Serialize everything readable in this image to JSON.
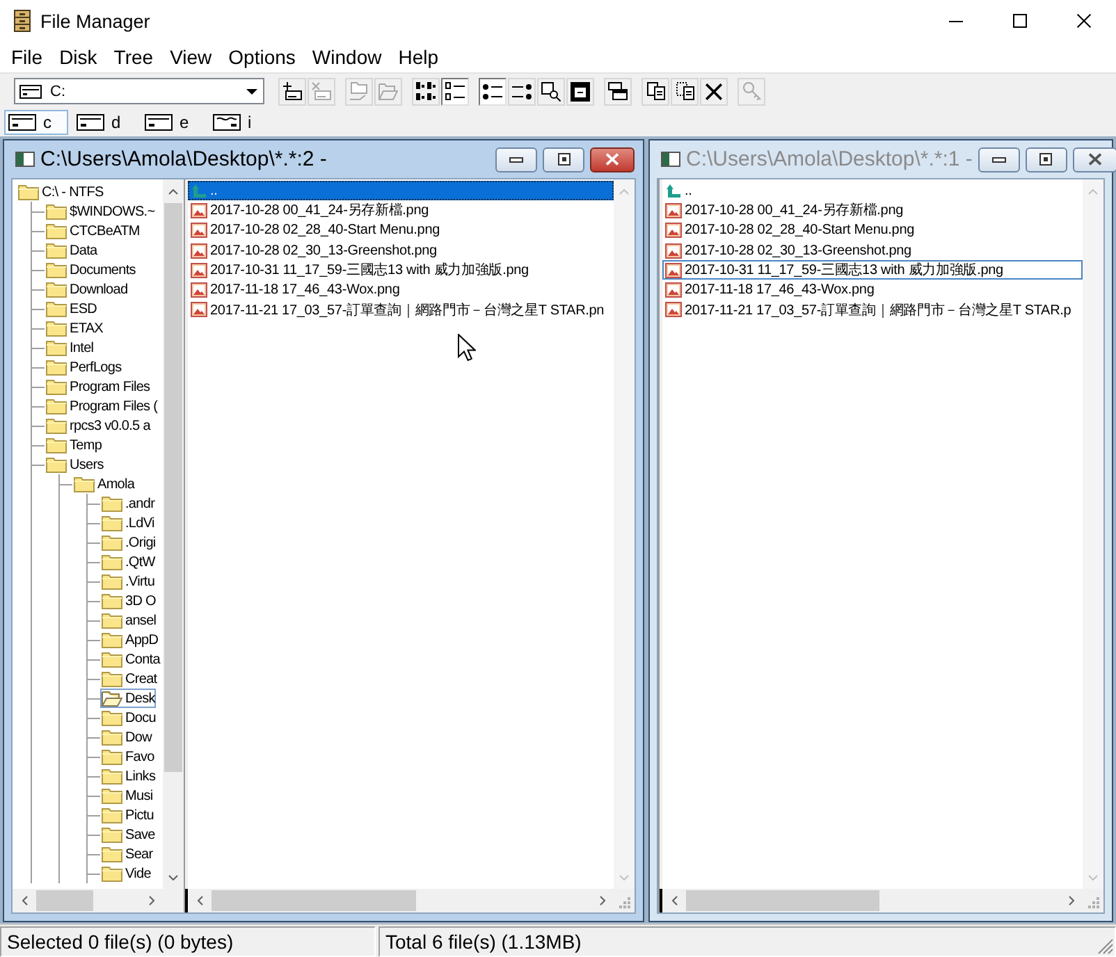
{
  "window": {
    "title": "File Manager"
  },
  "menu": [
    "File",
    "Disk",
    "Tree",
    "View",
    "Options",
    "Window",
    "Help"
  ],
  "toolbar": {
    "drive_combo": {
      "value": "C:"
    },
    "groups": [
      {
        "buttons": [
          {
            "kind": "connect",
            "pressed": false,
            "disabled": false
          },
          {
            "kind": "disconnect",
            "pressed": false,
            "disabled": true
          }
        ]
      },
      {
        "buttons": [
          {
            "kind": "share",
            "pressed": false,
            "disabled": true
          },
          {
            "kind": "unshare",
            "pressed": false,
            "disabled": true
          }
        ]
      },
      {
        "buttons": [
          {
            "kind": "grid",
            "pressed": false,
            "disabled": false
          },
          {
            "kind": "list",
            "pressed": true,
            "disabled": false
          }
        ]
      },
      {
        "buttons": [
          {
            "kind": "name",
            "pressed": true,
            "disabled": false
          },
          {
            "kind": "type",
            "pressed": false,
            "disabled": false
          },
          {
            "kind": "search",
            "pressed": false,
            "disabled": false
          },
          {
            "kind": "view",
            "pressed": false,
            "disabled": false
          }
        ]
      },
      {
        "buttons": [
          {
            "kind": "window",
            "pressed": false,
            "disabled": false
          }
        ]
      },
      {
        "buttons": [
          {
            "kind": "copy",
            "pressed": false,
            "disabled": false
          },
          {
            "kind": "move",
            "pressed": false,
            "disabled": false
          },
          {
            "kind": "delete",
            "pressed": false,
            "disabled": false
          }
        ]
      },
      {
        "buttons": [
          {
            "kind": "key",
            "pressed": false,
            "disabled": true
          }
        ]
      }
    ]
  },
  "drives": [
    {
      "letter": "c",
      "kind": "fixed",
      "selected": true
    },
    {
      "letter": "d",
      "kind": "fixed",
      "selected": false
    },
    {
      "letter": "e",
      "kind": "fixed",
      "selected": false
    },
    {
      "letter": "i",
      "kind": "network",
      "selected": false
    }
  ],
  "windows": [
    {
      "title": "C:\\Users\\Amola\\Desktop\\*.*:2 -",
      "active": true,
      "tree": [
        {
          "label": "C:\\ - NTFS",
          "selected": false,
          "children": [
            {
              "label": "$WINDOWS.~",
              "selected": false
            },
            {
              "label": "CTCBeATM",
              "selected": false
            },
            {
              "label": "Data",
              "selected": false
            },
            {
              "label": "Documents",
              "selected": false
            },
            {
              "label": "Download",
              "selected": false
            },
            {
              "label": "ESD",
              "selected": false
            },
            {
              "label": "ETAX",
              "selected": false
            },
            {
              "label": "Intel",
              "selected": false
            },
            {
              "label": "PerfLogs",
              "selected": false
            },
            {
              "label": "Program Files",
              "selected": false
            },
            {
              "label": "Program Files (",
              "selected": false
            },
            {
              "label": "rpcs3 v0.0.5 a",
              "selected": false
            },
            {
              "label": "Temp",
              "selected": false
            },
            {
              "label": "Users",
              "selected": false,
              "children": [
                {
                  "label": "Amola",
                  "selected": false,
                  "children": [
                    {
                      "label": ".andr",
                      "selected": false
                    },
                    {
                      "label": ".LdVi",
                      "selected": false
                    },
                    {
                      "label": ".Origi",
                      "selected": false
                    },
                    {
                      "label": ".QtW",
                      "selected": false
                    },
                    {
                      "label": ".Virtu",
                      "selected": false
                    },
                    {
                      "label": "3D O",
                      "selected": false
                    },
                    {
                      "label": "ansel",
                      "selected": false
                    },
                    {
                      "label": "AppD",
                      "selected": false
                    },
                    {
                      "label": "Conta",
                      "selected": false
                    },
                    {
                      "label": "Creat",
                      "selected": false
                    },
                    {
                      "label": "Desk",
                      "selected": true
                    },
                    {
                      "label": "Docu",
                      "selected": false
                    },
                    {
                      "label": "Dow",
                      "selected": false
                    },
                    {
                      "label": "Favo",
                      "selected": false
                    },
                    {
                      "label": "Links",
                      "selected": false
                    },
                    {
                      "label": "Musi",
                      "selected": false
                    },
                    {
                      "label": "Pictu",
                      "selected": false
                    },
                    {
                      "label": "Save",
                      "selected": false
                    },
                    {
                      "label": "Sear",
                      "selected": false
                    },
                    {
                      "label": "Vide",
                      "selected": false
                    }
                  ]
                }
              ]
            }
          ]
        }
      ],
      "files": [
        {
          "name": "..",
          "kind": "parent",
          "selected": true
        },
        {
          "name": "2017-10-28 00_41_24-另存新檔.png",
          "kind": "image",
          "selected": false
        },
        {
          "name": "2017-10-28 02_28_40-Start Menu.png",
          "kind": "image",
          "selected": false
        },
        {
          "name": "2017-10-28 02_30_13-Greenshot.png",
          "kind": "image",
          "selected": false
        },
        {
          "name": "2017-10-31 11_17_59-三國志13 with 威力加強版.png",
          "kind": "image",
          "selected": false
        },
        {
          "name": "2017-11-18 17_46_43-Wox.png",
          "kind": "image",
          "selected": false
        },
        {
          "name": "2017-11-21 17_03_57-訂單查詢｜網路門市－台灣之星T STAR.pn",
          "kind": "image",
          "selected": false
        }
      ]
    },
    {
      "title": "C:\\Users\\Amola\\Desktop\\*.*:1 -",
      "active": false,
      "files": [
        {
          "name": "..",
          "kind": "parent",
          "selected": false
        },
        {
          "name": "2017-10-28 00_41_24-另存新檔.png",
          "kind": "image",
          "selected": false
        },
        {
          "name": "2017-10-28 02_28_40-Start Menu.png",
          "kind": "image",
          "selected": false
        },
        {
          "name": "2017-10-28 02_30_13-Greenshot.png",
          "kind": "image",
          "selected": false
        },
        {
          "name": "2017-10-31 11_17_59-三國志13 with 威力加強版.png",
          "kind": "image",
          "selected": true
        },
        {
          "name": "2017-11-18 17_46_43-Wox.png",
          "kind": "image",
          "selected": false
        },
        {
          "name": "2017-11-21 17_03_57-訂單查詢｜網路門市－台灣之星T STAR.p",
          "kind": "image",
          "selected": false
        }
      ]
    }
  ],
  "status_bar": {
    "selection": "Selected 0 file(s) (0 bytes)",
    "total": "Total 6 file(s) (1.13MB)"
  }
}
